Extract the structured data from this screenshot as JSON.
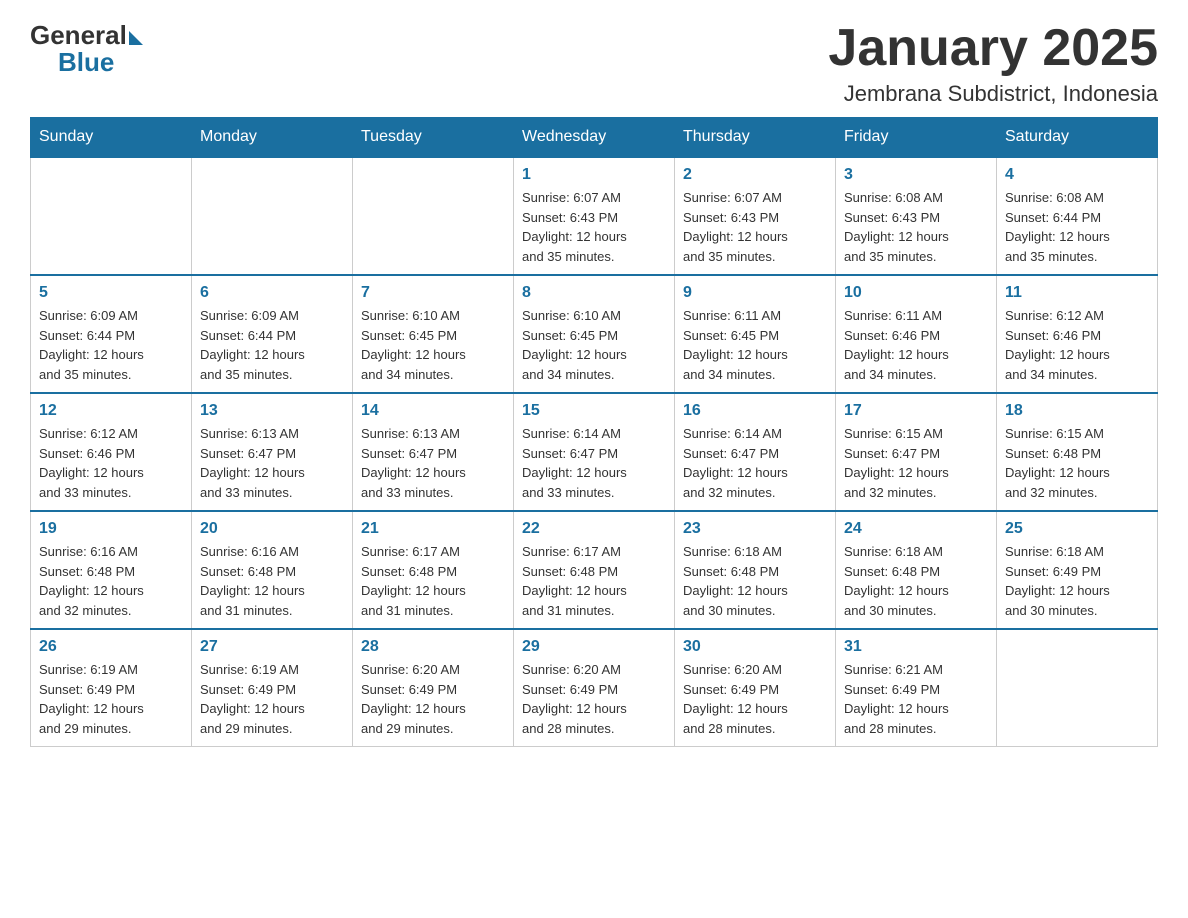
{
  "header": {
    "logo_general": "General",
    "logo_blue": "Blue",
    "title": "January 2025",
    "subtitle": "Jembrana Subdistrict, Indonesia"
  },
  "days_of_week": [
    "Sunday",
    "Monday",
    "Tuesday",
    "Wednesday",
    "Thursday",
    "Friday",
    "Saturday"
  ],
  "weeks": [
    [
      {
        "day": "",
        "info": ""
      },
      {
        "day": "",
        "info": ""
      },
      {
        "day": "",
        "info": ""
      },
      {
        "day": "1",
        "info": "Sunrise: 6:07 AM\nSunset: 6:43 PM\nDaylight: 12 hours\nand 35 minutes."
      },
      {
        "day": "2",
        "info": "Sunrise: 6:07 AM\nSunset: 6:43 PM\nDaylight: 12 hours\nand 35 minutes."
      },
      {
        "day": "3",
        "info": "Sunrise: 6:08 AM\nSunset: 6:43 PM\nDaylight: 12 hours\nand 35 minutes."
      },
      {
        "day": "4",
        "info": "Sunrise: 6:08 AM\nSunset: 6:44 PM\nDaylight: 12 hours\nand 35 minutes."
      }
    ],
    [
      {
        "day": "5",
        "info": "Sunrise: 6:09 AM\nSunset: 6:44 PM\nDaylight: 12 hours\nand 35 minutes."
      },
      {
        "day": "6",
        "info": "Sunrise: 6:09 AM\nSunset: 6:44 PM\nDaylight: 12 hours\nand 35 minutes."
      },
      {
        "day": "7",
        "info": "Sunrise: 6:10 AM\nSunset: 6:45 PM\nDaylight: 12 hours\nand 34 minutes."
      },
      {
        "day": "8",
        "info": "Sunrise: 6:10 AM\nSunset: 6:45 PM\nDaylight: 12 hours\nand 34 minutes."
      },
      {
        "day": "9",
        "info": "Sunrise: 6:11 AM\nSunset: 6:45 PM\nDaylight: 12 hours\nand 34 minutes."
      },
      {
        "day": "10",
        "info": "Sunrise: 6:11 AM\nSunset: 6:46 PM\nDaylight: 12 hours\nand 34 minutes."
      },
      {
        "day": "11",
        "info": "Sunrise: 6:12 AM\nSunset: 6:46 PM\nDaylight: 12 hours\nand 34 minutes."
      }
    ],
    [
      {
        "day": "12",
        "info": "Sunrise: 6:12 AM\nSunset: 6:46 PM\nDaylight: 12 hours\nand 33 minutes."
      },
      {
        "day": "13",
        "info": "Sunrise: 6:13 AM\nSunset: 6:47 PM\nDaylight: 12 hours\nand 33 minutes."
      },
      {
        "day": "14",
        "info": "Sunrise: 6:13 AM\nSunset: 6:47 PM\nDaylight: 12 hours\nand 33 minutes."
      },
      {
        "day": "15",
        "info": "Sunrise: 6:14 AM\nSunset: 6:47 PM\nDaylight: 12 hours\nand 33 minutes."
      },
      {
        "day": "16",
        "info": "Sunrise: 6:14 AM\nSunset: 6:47 PM\nDaylight: 12 hours\nand 32 minutes."
      },
      {
        "day": "17",
        "info": "Sunrise: 6:15 AM\nSunset: 6:47 PM\nDaylight: 12 hours\nand 32 minutes."
      },
      {
        "day": "18",
        "info": "Sunrise: 6:15 AM\nSunset: 6:48 PM\nDaylight: 12 hours\nand 32 minutes."
      }
    ],
    [
      {
        "day": "19",
        "info": "Sunrise: 6:16 AM\nSunset: 6:48 PM\nDaylight: 12 hours\nand 32 minutes."
      },
      {
        "day": "20",
        "info": "Sunrise: 6:16 AM\nSunset: 6:48 PM\nDaylight: 12 hours\nand 31 minutes."
      },
      {
        "day": "21",
        "info": "Sunrise: 6:17 AM\nSunset: 6:48 PM\nDaylight: 12 hours\nand 31 minutes."
      },
      {
        "day": "22",
        "info": "Sunrise: 6:17 AM\nSunset: 6:48 PM\nDaylight: 12 hours\nand 31 minutes."
      },
      {
        "day": "23",
        "info": "Sunrise: 6:18 AM\nSunset: 6:48 PM\nDaylight: 12 hours\nand 30 minutes."
      },
      {
        "day": "24",
        "info": "Sunrise: 6:18 AM\nSunset: 6:48 PM\nDaylight: 12 hours\nand 30 minutes."
      },
      {
        "day": "25",
        "info": "Sunrise: 6:18 AM\nSunset: 6:49 PM\nDaylight: 12 hours\nand 30 minutes."
      }
    ],
    [
      {
        "day": "26",
        "info": "Sunrise: 6:19 AM\nSunset: 6:49 PM\nDaylight: 12 hours\nand 29 minutes."
      },
      {
        "day": "27",
        "info": "Sunrise: 6:19 AM\nSunset: 6:49 PM\nDaylight: 12 hours\nand 29 minutes."
      },
      {
        "day": "28",
        "info": "Sunrise: 6:20 AM\nSunset: 6:49 PM\nDaylight: 12 hours\nand 29 minutes."
      },
      {
        "day": "29",
        "info": "Sunrise: 6:20 AM\nSunset: 6:49 PM\nDaylight: 12 hours\nand 28 minutes."
      },
      {
        "day": "30",
        "info": "Sunrise: 6:20 AM\nSunset: 6:49 PM\nDaylight: 12 hours\nand 28 minutes."
      },
      {
        "day": "31",
        "info": "Sunrise: 6:21 AM\nSunset: 6:49 PM\nDaylight: 12 hours\nand 28 minutes."
      },
      {
        "day": "",
        "info": ""
      }
    ]
  ]
}
